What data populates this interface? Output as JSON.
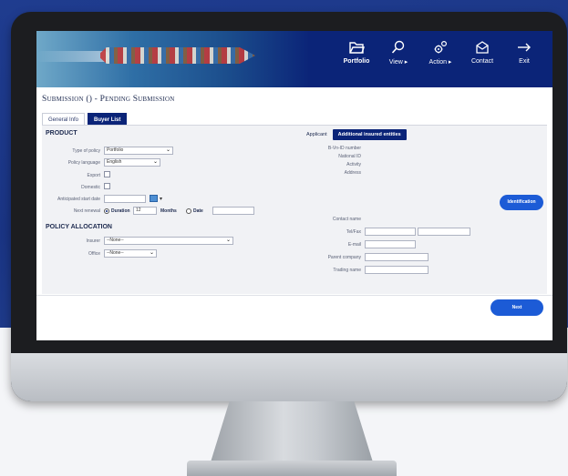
{
  "nav": {
    "items": [
      {
        "label": "Portfolio",
        "icon": "folder-icon"
      },
      {
        "label": "View ▸",
        "icon": "search-icon"
      },
      {
        "label": "Action ▸",
        "icon": "gears-icon"
      },
      {
        "label": "Contact",
        "icon": "mail-icon"
      },
      {
        "label": "Exit",
        "icon": "exit-arrow-icon"
      }
    ]
  },
  "page": {
    "title": "Submission () - Pending Submission"
  },
  "tabs": [
    {
      "label": "General Info",
      "active": false
    },
    {
      "label": "Buyer List",
      "active": true
    }
  ],
  "product": {
    "heading": "PRODUCT",
    "type_of_policy_label": "Type of policy",
    "type_of_policy_value": "Portfolio",
    "policy_language_label": "Policy language",
    "policy_language_value": "English",
    "export_label": "Export",
    "domestic_label": "Domestic",
    "start_date_label": "Anticipated start date",
    "start_date_value": "",
    "renewal_label": "Next renewal",
    "duration_label": "Duration",
    "duration_value": "12",
    "months_label": "Months",
    "date_label": "Date",
    "date_value": ""
  },
  "allocation": {
    "heading": "POLICY ALLOCATION",
    "insurer_label": "Insurer",
    "insurer_value": "--None--",
    "office_label": "Office",
    "office_value": "--None--"
  },
  "applicant": {
    "tabs": [
      {
        "label": "Applicant",
        "active": false
      },
      {
        "label": "Additional insured entities",
        "active": true
      }
    ],
    "fields": {
      "bvd_label": "B-Vn-ID number",
      "national_id_label": "National ID",
      "activity_label": "Activity",
      "address_label": "Address"
    },
    "identification_button": "Identification",
    "contact_name_label": "Contact name",
    "tel_fax_label": "Tel/Fax",
    "email_label": "E-mail",
    "parent_company_label": "Parent company",
    "trading_name_label": "Trading name"
  },
  "footer": {
    "next_button": "Next"
  },
  "colors": {
    "brand_navy": "#0b2478",
    "action_blue": "#1c5bd6"
  }
}
